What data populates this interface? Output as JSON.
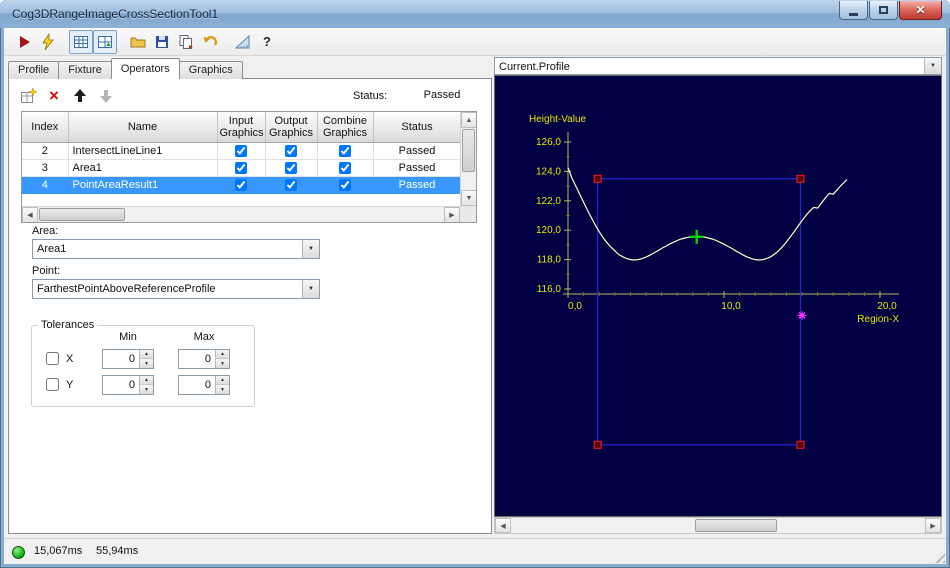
{
  "window": {
    "title": "Cog3DRangeImageCrossSectionTool1"
  },
  "toolbar": {
    "icons": [
      "run",
      "trigger",
      "image-display-toggle",
      "graphics-display-toggle",
      "open-file",
      "save-file",
      "copy-results",
      "reset",
      "measure",
      "help"
    ]
  },
  "tabs": [
    {
      "label": "Profile",
      "active": false
    },
    {
      "label": "Fixture",
      "active": false
    },
    {
      "label": "Operators",
      "active": true
    },
    {
      "label": "Graphics",
      "active": false
    }
  ],
  "operators": {
    "status_label": "Status:",
    "status_value": "Passed",
    "table": {
      "headers": [
        "Index",
        "Name",
        "Input Graphics",
        "Output Graphics",
        "Combine Graphics",
        "Status"
      ],
      "rows": [
        {
          "index": "2",
          "name": "IntersectLineLine1",
          "input": true,
          "output": true,
          "combine": true,
          "status": "Passed",
          "selected": false
        },
        {
          "index": "3",
          "name": "Area1",
          "input": true,
          "output": true,
          "combine": true,
          "status": "Passed",
          "selected": false
        },
        {
          "index": "4",
          "name": "PointAreaResult1",
          "input": true,
          "output": true,
          "combine": true,
          "status": "Passed",
          "selected": true
        }
      ]
    },
    "area_label": "Area:",
    "area_value": "Area1",
    "point_label": "Point:",
    "point_value": "FarthestPointAboveReferenceProfile",
    "tolerances": {
      "legend": "Tolerances",
      "min_header": "Min",
      "max_header": "Max",
      "rows": [
        {
          "label": "X",
          "checked": false,
          "min": "0",
          "max": "0"
        },
        {
          "label": "Y",
          "checked": false,
          "min": "0",
          "max": "0"
        }
      ]
    }
  },
  "display": {
    "selector_value": "Current.Profile"
  },
  "statusbar": {
    "time1": "15,067ms",
    "time2": "55,94ms"
  },
  "chart_data": {
    "type": "line",
    "title": "Current.Profile",
    "xlabel": "Region-X",
    "ylabel": "Height-Value",
    "x_ticks": [
      0,
      10,
      20
    ],
    "x_tick_labels": [
      "0,0",
      "10,0",
      "20,0"
    ],
    "y_ticks": [
      126,
      124,
      122,
      120,
      118,
      116
    ],
    "y_tick_labels": [
      "126,0",
      "124,0",
      "122,0",
      "120,0",
      "118,0",
      "116,0"
    ],
    "xlim": [
      0,
      21
    ],
    "ylim": [
      115.7,
      127
    ],
    "background": "#000042",
    "axis_color": "#b8b860",
    "minor_tick_color": "#70702e",
    "label_color": "#e8e800",
    "series": [
      {
        "name": "profile",
        "color": "#ffffc0",
        "points": [
          [
            0,
            124.25
          ],
          [
            0.25,
            123.55
          ],
          [
            0.5,
            123.0
          ],
          [
            0.75,
            122.45
          ],
          [
            1.0,
            121.9
          ],
          [
            1.25,
            121.35
          ],
          [
            1.5,
            120.85
          ],
          [
            1.75,
            120.35
          ],
          [
            2.0,
            119.9
          ],
          [
            2.25,
            119.5
          ],
          [
            2.5,
            119.15
          ],
          [
            2.75,
            118.85
          ],
          [
            3.0,
            118.6
          ],
          [
            3.25,
            118.35
          ],
          [
            3.5,
            118.2
          ],
          [
            3.75,
            118.08
          ],
          [
            4.0,
            118.0
          ],
          [
            4.25,
            117.97
          ],
          [
            4.5,
            118.0
          ],
          [
            4.75,
            118.07
          ],
          [
            5.0,
            118.17
          ],
          [
            5.25,
            118.3
          ],
          [
            5.5,
            118.45
          ],
          [
            5.75,
            118.6
          ],
          [
            6.0,
            118.76
          ],
          [
            6.25,
            118.9
          ],
          [
            6.5,
            119.05
          ],
          [
            6.75,
            119.18
          ],
          [
            7.0,
            119.3
          ],
          [
            7.25,
            119.4
          ],
          [
            7.5,
            119.47
          ],
          [
            7.75,
            119.53
          ],
          [
            8.0,
            119.57
          ],
          [
            8.25,
            119.58
          ],
          [
            8.5,
            119.57
          ],
          [
            8.75,
            119.53
          ],
          [
            9.0,
            119.47
          ],
          [
            9.25,
            119.4
          ],
          [
            9.5,
            119.3
          ],
          [
            9.75,
            119.18
          ],
          [
            10.0,
            119.05
          ],
          [
            10.25,
            118.9
          ],
          [
            10.5,
            118.76
          ],
          [
            10.75,
            118.6
          ],
          [
            11.0,
            118.45
          ],
          [
            11.25,
            118.3
          ],
          [
            11.5,
            118.17
          ],
          [
            11.75,
            118.07
          ],
          [
            12.0,
            118.0
          ],
          [
            12.25,
            117.97
          ],
          [
            12.5,
            118.0
          ],
          [
            12.75,
            118.08
          ],
          [
            13.0,
            118.2
          ],
          [
            13.25,
            118.38
          ],
          [
            13.5,
            118.6
          ],
          [
            13.75,
            118.88
          ],
          [
            14.0,
            119.2
          ],
          [
            14.25,
            119.55
          ],
          [
            14.5,
            119.9
          ],
          [
            14.75,
            120.28
          ],
          [
            15.0,
            120.65
          ],
          [
            15.25,
            121.0
          ],
          [
            15.5,
            121.3
          ],
          [
            15.75,
            121.55
          ],
          [
            16.0,
            121.5
          ],
          [
            16.25,
            121.85
          ],
          [
            16.5,
            122.2
          ],
          [
            16.75,
            122.5
          ],
          [
            17.0,
            122.45
          ],
          [
            17.25,
            122.75
          ],
          [
            17.5,
            123.05
          ],
          [
            17.75,
            123.3
          ],
          [
            17.9,
            123.45
          ]
        ]
      }
    ],
    "region_box": {
      "x1": 1.9,
      "x2": 14.9,
      "y1": 123.5,
      "y2": 105.4,
      "color": "#2626d8",
      "corner_color": "#ff1f1f"
    },
    "markers": [
      {
        "name": "farthest-point-marker",
        "x": 8.25,
        "y": 119.55,
        "shape": "cross",
        "color": "#00d800"
      },
      {
        "name": "result-point-marker",
        "x": 15.0,
        "y": 114.2,
        "shape": "star",
        "color": "#ff35ff"
      }
    ]
  }
}
